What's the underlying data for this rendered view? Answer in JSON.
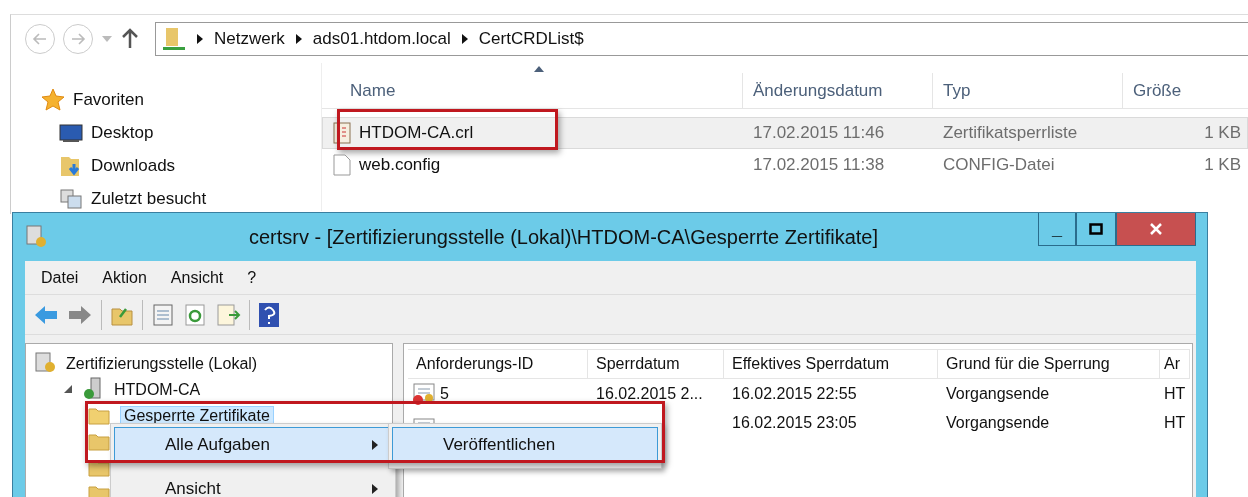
{
  "explorer": {
    "address": {
      "segments": [
        "Netzwerk",
        "ads01.htdom.local",
        "CertCRDList$"
      ]
    },
    "sidebar": {
      "items": [
        {
          "label": "Favoriten",
          "kind": "star"
        },
        {
          "label": "Desktop",
          "kind": "desktop"
        },
        {
          "label": "Downloads",
          "kind": "downloads"
        },
        {
          "label": "Zuletzt besucht",
          "kind": "recent"
        }
      ]
    },
    "file_list": {
      "columns": [
        {
          "label": "Name",
          "sorted": true
        },
        {
          "label": "Änderungsdatum",
          "sorted": false
        },
        {
          "label": "Typ",
          "sorted": false
        },
        {
          "label": "Größe",
          "sorted": false
        }
      ],
      "rows": [
        {
          "name": "HTDOM-CA.crl",
          "modified": "17.02.2015 11:46",
          "type": "Zertifikatsperrliste",
          "size": "1 KB",
          "kind": "crl",
          "selected": true,
          "annotated": true
        },
        {
          "name": "web.config",
          "modified": "17.02.2015 11:38",
          "type": "CONFIG-Datei",
          "size": "1 KB",
          "kind": "file",
          "selected": false,
          "annotated": false
        }
      ]
    }
  },
  "mmc": {
    "window": {
      "title": "certsrv - [Zertifizierungsstelle (Lokal)\\HTDOM-CA\\Gesperrte Zertifikate]",
      "buttons": [
        "_"
      ]
    },
    "menu": [
      "Datei",
      "Aktion",
      "Ansicht",
      "?"
    ],
    "tree": [
      {
        "label": "Zertifizierungsstelle (Lokal)",
        "kind": "root",
        "children": [
          {
            "label": "HTDOM-CA",
            "kind": "server",
            "expanded": true,
            "children": [
              {
                "label": "Gesperrte Zertifikate",
                "kind": "folder",
                "selected": true
              },
              {
                "kind": "folder"
              },
              {
                "kind": "folder"
              },
              {
                "kind": "folder"
              }
            ]
          }
        ]
      }
    ],
    "table": {
      "columns": [
        "Anforderungs-ID",
        "Sperrdatum",
        "Effektives Sperrdatum",
        "Grund für die Sperrung",
        "Ar"
      ],
      "rows": [
        {
          "revoked": true,
          "id": "5",
          "date": "16.02.2015 2...",
          "effective": "16.02.2015 22:55",
          "reason": "Vorgangsende",
          "column_5": "HT"
        },
        {
          "effective": "16.02.2015 23:05",
          "reason": "Vorgangsende",
          "column_5": "HT"
        }
      ]
    },
    "context_menu": {
      "annotated": true,
      "items": [
        {
          "label": "Alle Aufgaben",
          "selected": true,
          "submenu": true
        },
        {
          "label": "Ansicht",
          "selected": false,
          "submenu": true
        }
      ],
      "submenu": {
        "items": [
          {
            "label": "Veröffentlichen",
            "selected": true
          }
        ]
      }
    }
  }
}
